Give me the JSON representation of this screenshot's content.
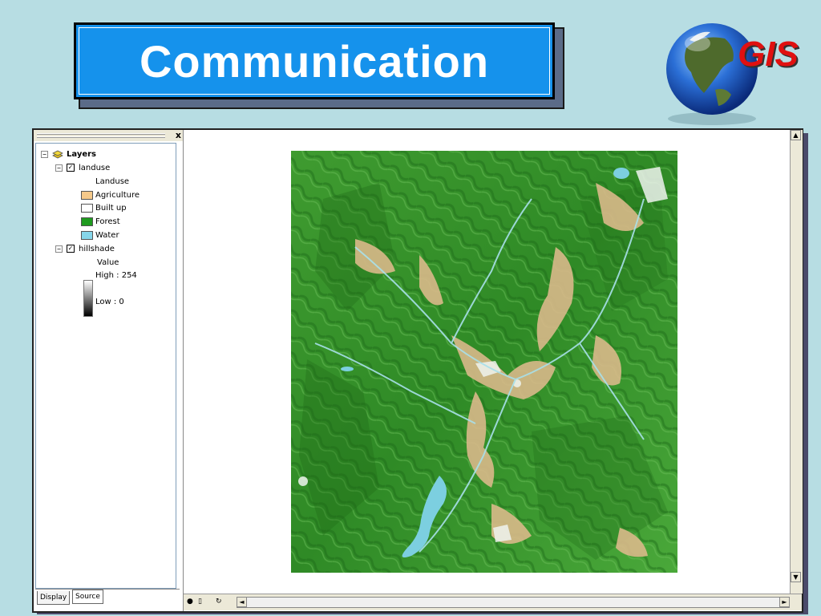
{
  "slide": {
    "title": "Communication",
    "logo_text": "GIS"
  },
  "toc": {
    "close_glyph": "x",
    "root": {
      "label": "Layers",
      "expander": "−"
    },
    "landuse": {
      "label": "landuse",
      "expander": "−",
      "checked": "✓",
      "field": "Landuse",
      "classes": [
        {
          "label": "Agriculture",
          "color": "#f5c98a"
        },
        {
          "label": "Built up",
          "color": "#ffffff"
        },
        {
          "label": "Forest",
          "color": "#1f9b1f"
        },
        {
          "label": "Water",
          "color": "#86d6ea"
        }
      ]
    },
    "hillshade": {
      "label": "hillshade",
      "expander": "−",
      "checked": "✓",
      "field": "Value",
      "high": "High : 254",
      "low": "Low : 0"
    },
    "tabs": {
      "display": "Display",
      "source": "Source"
    }
  },
  "map": {
    "description_colors": {
      "forest": "#3a9a2a",
      "agri": "#d9b98a",
      "water": "#7ccfe0"
    }
  },
  "scroll": {
    "up": "▲",
    "down": "▼",
    "left": "◄",
    "right": "►"
  },
  "statusbar": {
    "icons": [
      "●",
      "▯",
      "↻"
    ]
  }
}
